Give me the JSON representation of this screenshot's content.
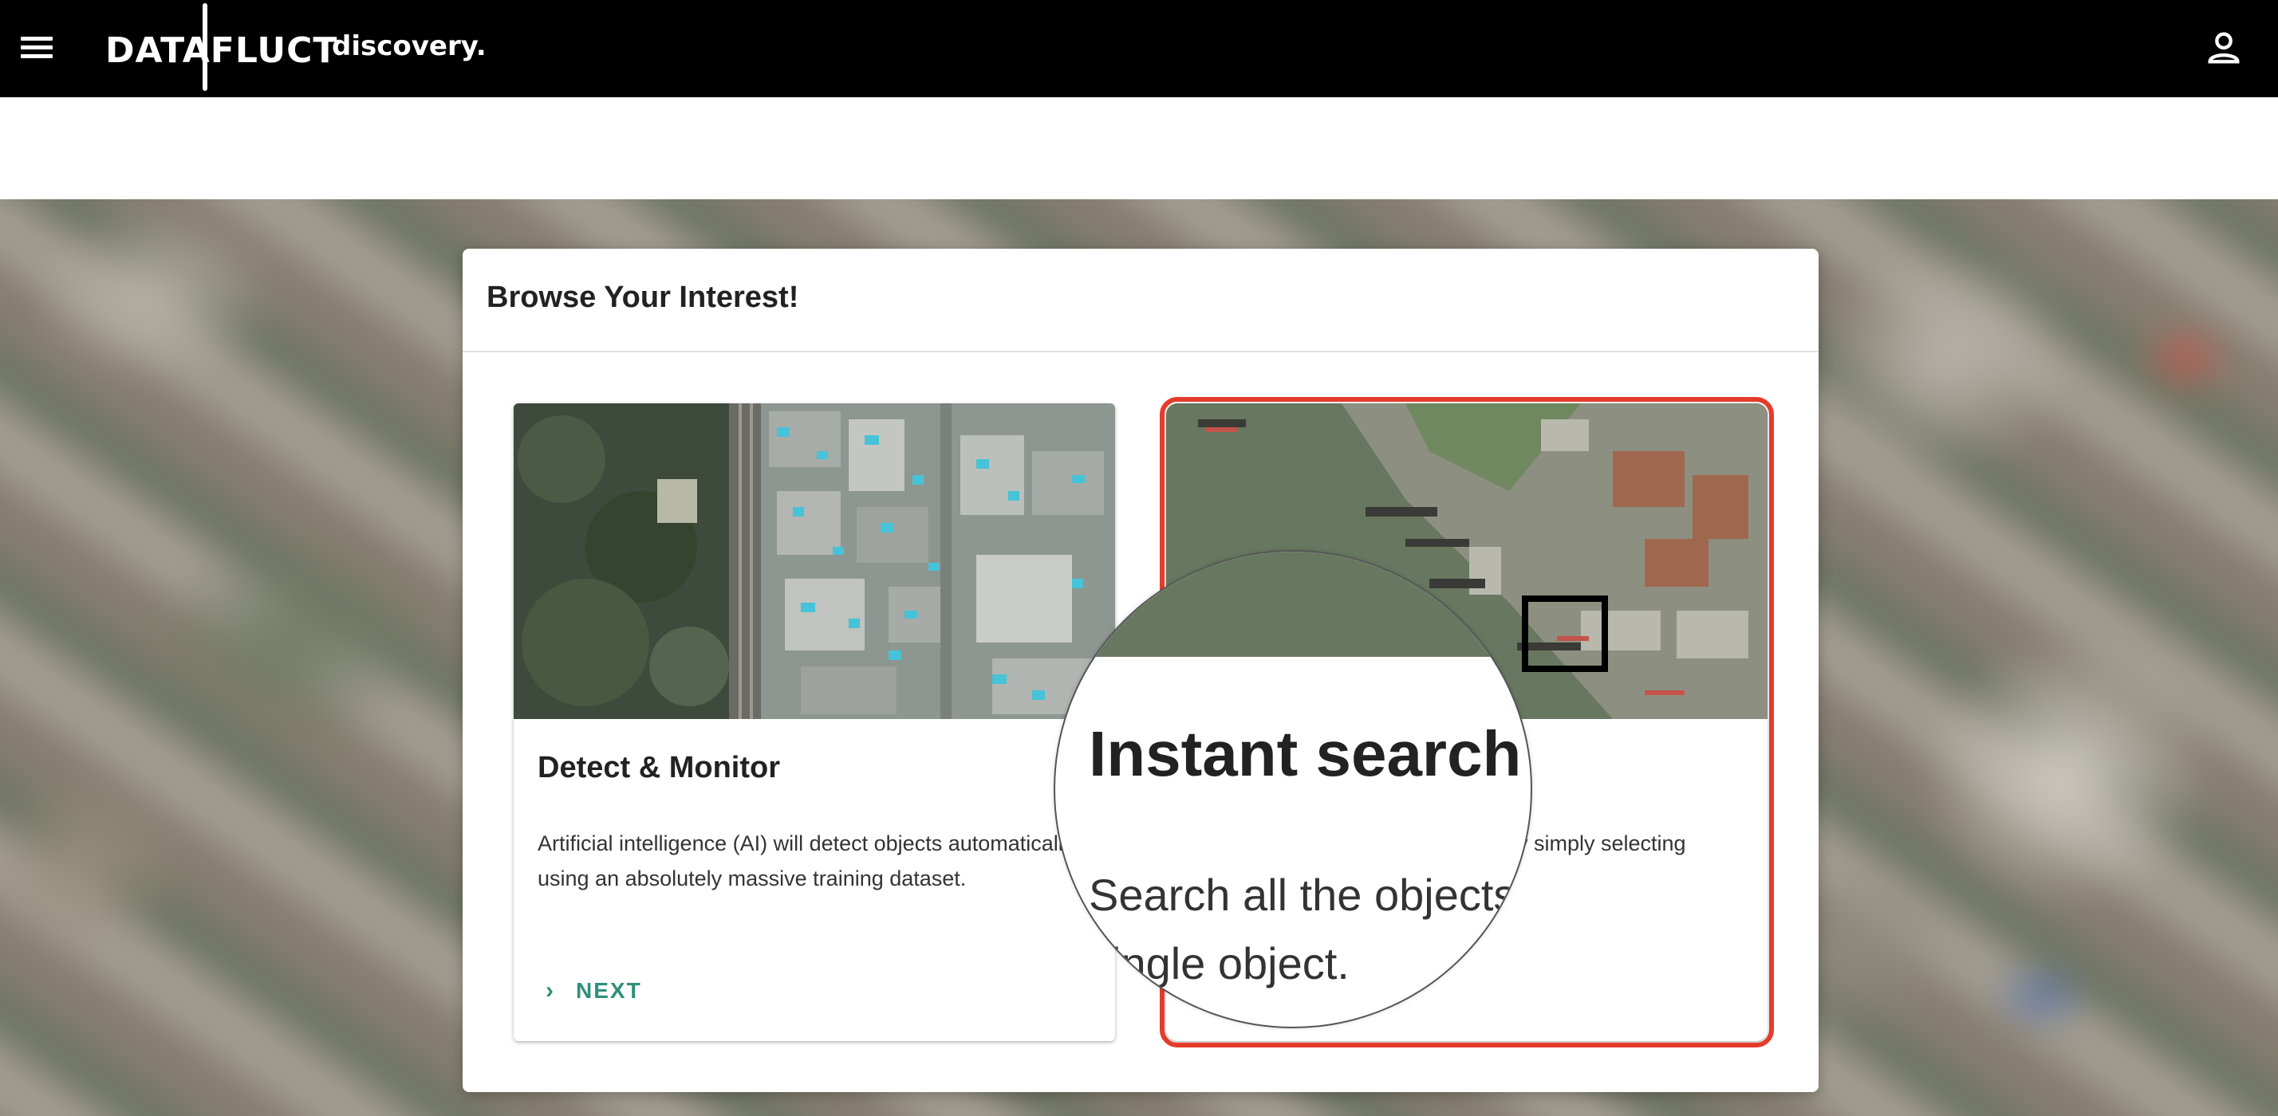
{
  "header": {
    "logo_main": "DATAFLUCT",
    "logo_sub": "discovery.",
    "menu_icon": "menu-icon",
    "profile_icon": "person-icon"
  },
  "dialog": {
    "title": "Browse Your Interest!"
  },
  "cards": [
    {
      "title": "Detect & Monitor",
      "description": "Artificial intelligence (AI) will detect objects automatically using an absolutely massive training dataset.",
      "action_label": "NEXT",
      "action_icon": "chevron-right-icon"
    },
    {
      "description_fragment": "y simply selecting",
      "highlight_color": "#e53b2c"
    }
  ],
  "magnifier": {
    "title": "Instant search",
    "line1": "Search all the objects",
    "line2": "ingle object."
  },
  "colors": {
    "accent": "#2e8f7c",
    "appbar": "#000000",
    "highlight": "#e53b2c"
  }
}
